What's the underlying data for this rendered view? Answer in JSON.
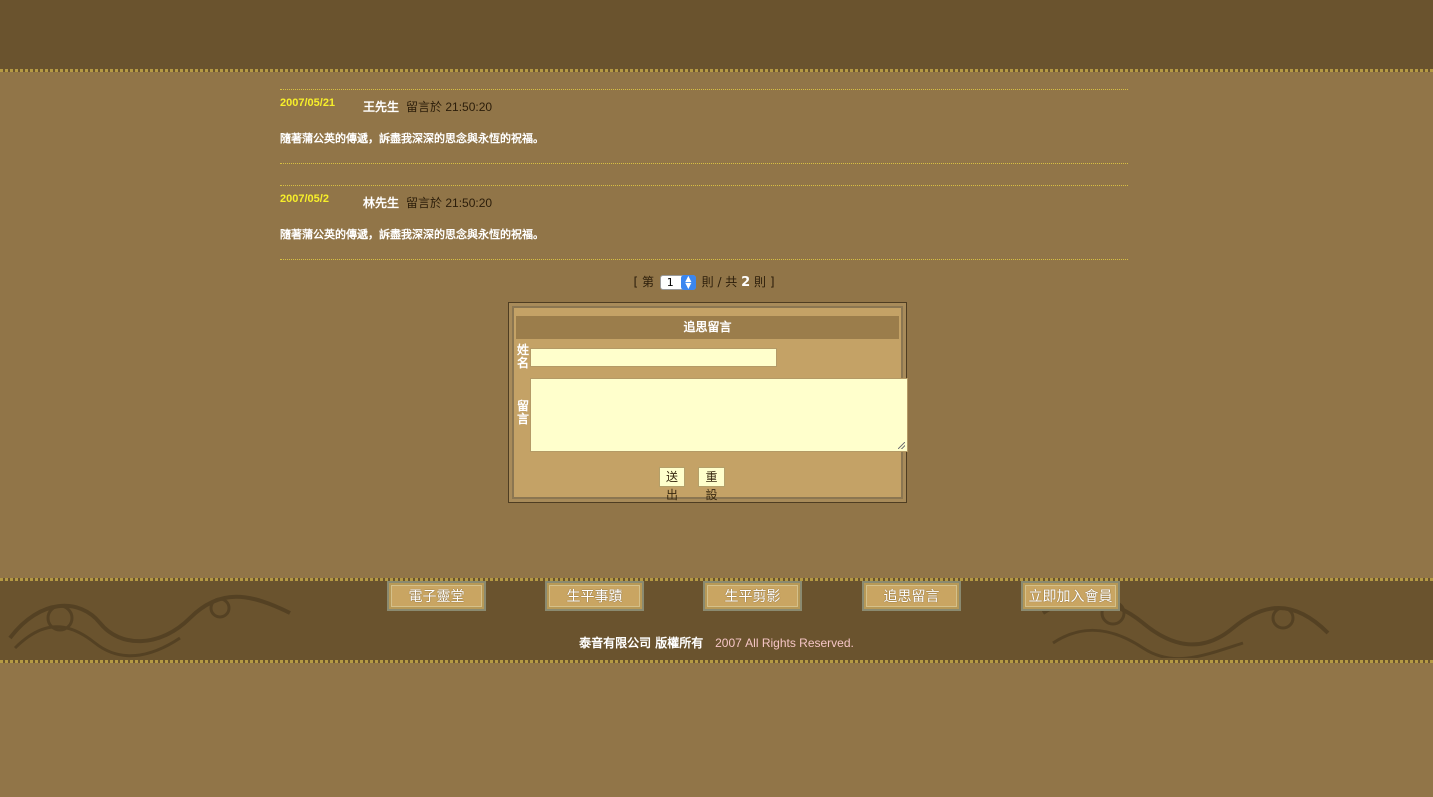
{
  "messages": [
    {
      "date": "2007/05/21",
      "author": "王先生",
      "posted_label": "留言於",
      "time": "21:50:20",
      "body": "隨著蒲公英的傳遞，訴盡我深深的思念與永恆的祝福。"
    },
    {
      "date": "2007/05/2",
      "author": "林先生",
      "posted_label": "留言於",
      "time": "21:50:20",
      "body": "隨著蒲公英的傳遞，訴盡我深深的思念與永恆的祝福。"
    }
  ],
  "pager": {
    "prefix": "[ 第",
    "current": "1",
    "middle": "則 / 共",
    "total": "2",
    "suffix": "則 ]"
  },
  "form": {
    "title": "追思留言",
    "name_label": "姓名",
    "message_label": "留言",
    "name_value": "",
    "message_value": "",
    "submit_label": "送出",
    "reset_label": "重設"
  },
  "footer_nav": [
    {
      "label": "電子靈堂"
    },
    {
      "label": "生平事蹟"
    },
    {
      "label": "生平剪影"
    },
    {
      "label": "追思留言"
    },
    {
      "label": "立即加入會員"
    }
  ],
  "footer": {
    "company": "泰音有限公司 版權所有",
    "rights": "2007 All Rights Reserved."
  },
  "colors": {
    "background": "#917548",
    "band": "#6a532e",
    "date": "#f7ef2a",
    "input": "#ffffcc"
  }
}
